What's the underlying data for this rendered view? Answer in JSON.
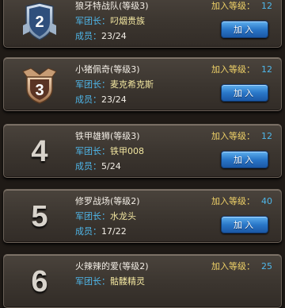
{
  "guilds": [
    {
      "rank": "2",
      "name": "狼牙特战队(等级3)",
      "leader_label": "军团长：",
      "leader": "叼烟贵族",
      "members_label": "成员：",
      "members": "23/24",
      "level_label": "加入等级：",
      "level": "12",
      "join_label": "加入",
      "emblem": "silver-rank-badge-icon"
    },
    {
      "rank": "3",
      "name": "小猪佩奇(等级3)",
      "leader_label": "军团长：",
      "leader": "麦克希克斯",
      "members_label": "成员：",
      "members": "23/24",
      "level_label": "加入等级：",
      "level": "12",
      "join_label": "加入",
      "emblem": "bronze-rank-badge-icon"
    },
    {
      "rank": "4",
      "name": "铁甲雄狮(等级3)",
      "leader_label": "军团长：",
      "leader": "铁甲008",
      "members_label": "成员：",
      "members": "5/24",
      "level_label": "加入等级：",
      "level": "12",
      "join_label": "加入"
    },
    {
      "rank": "5",
      "name": "修罗战场(等级2)",
      "leader_label": "军团长：",
      "leader": "水龙头",
      "members_label": "成员：",
      "members": "17/22",
      "level_label": "加入等级：",
      "level": "40",
      "join_label": "加入"
    },
    {
      "rank": "6",
      "name": "火辣辣的爱(等级2)",
      "leader_label": "军团长：",
      "leader": "骷髅精灵",
      "level_label": "加入等级：",
      "level": "25"
    }
  ],
  "colors": {
    "label_blue": "#4fb7ea",
    "level_gold": "#f0d268",
    "button_blue": "#2a77c8"
  }
}
